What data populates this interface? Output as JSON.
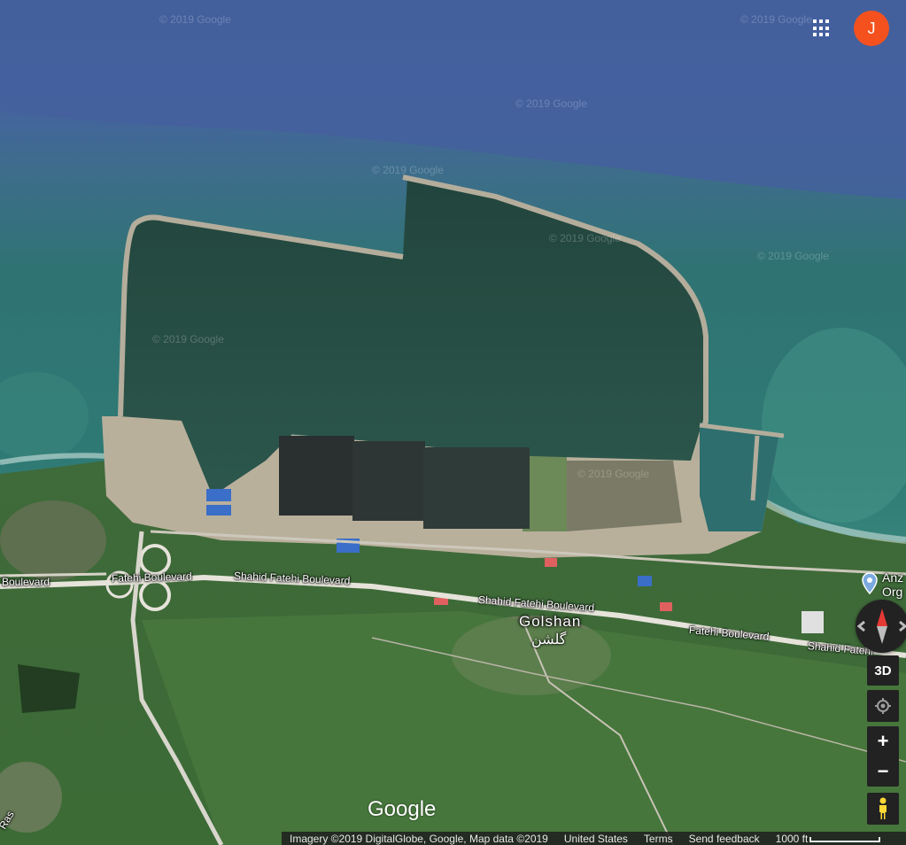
{
  "watermarks": [
    "© 2019 Google",
    "© 2019 Google",
    "© 2019 Google",
    "© 2019 Google",
    "© 2019 Google",
    "© 2019 Google",
    "© 2019 Google",
    "© 2019 Google"
  ],
  "header": {
    "apps_icon": "apps-grid-icon",
    "avatar_letter": "J",
    "avatar_color": "#f4511e"
  },
  "roads": {
    "boulevard_left": "Boulevard",
    "fatehi_boulevard_1": "Fatehi Boulevard",
    "shahid_fatehi_boulevard_1": "Shahid Fatehi Boulevard",
    "shahid_fatehi_boulevard_2": "Shahid Fatehi Boulevard",
    "fatehi_boulevard_2": "Fatehi Boulevard",
    "shahid_fatehi_edge": "Shahid Fatehi",
    "ras_edge": "Ras"
  },
  "places": {
    "golshan_en": "Golshan",
    "golshan_fa": "گلشن"
  },
  "poi": {
    "line1": "Anz",
    "line2": "Org",
    "icon": "map-pin-icon"
  },
  "controls": {
    "compass_icon": "compass-icon",
    "three_d_label": "3D",
    "my_location_icon": "my-location-icon",
    "zoom_in_label": "+",
    "zoom_out_label": "−",
    "pegman_icon": "pegman-icon"
  },
  "logo": "Google",
  "footer": {
    "imagery": "Imagery ©2019 DigitalGlobe, Google, Map data ©2019",
    "country": "United States",
    "terms": "Terms",
    "feedback": "Send feedback",
    "scale": "1000 ft"
  }
}
